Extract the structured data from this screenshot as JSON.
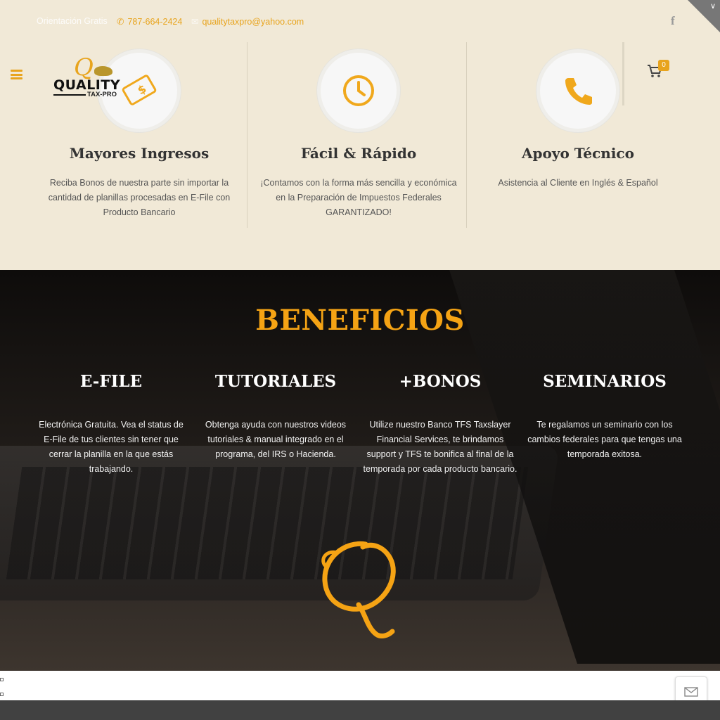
{
  "topbar": {
    "orientation": "Orientación Gratis",
    "phone": "787-664-2424",
    "email": "qualitytaxpro@yahoo.com",
    "phone_icon": "phone-icon",
    "email_icon": "mail-icon",
    "social_icon": "facebook-icon"
  },
  "header": {
    "logo_text": "QUALITY",
    "logo_subtext": "TAX-PRO",
    "cart_count": "0"
  },
  "features": [
    {
      "icon": "money-icon",
      "title": "Mayores Ingresos",
      "text": "Reciba Bonos de nuestra parte sin importar la cantidad de planillas procesadas en E-File con Producto Bancario"
    },
    {
      "icon": "clock-icon",
      "title": "Fácil & Rápido",
      "text": "¡Contamos con la forma más sencilla y económica en la Preparación de Impuestos Federales GARANTIZADO!"
    },
    {
      "icon": "phone-icon",
      "title": "Apoyo Técnico",
      "text": "Asistencia al Cliente en Inglés & Español"
    }
  ],
  "benefits": {
    "title": "BENEFICIOS",
    "items": [
      {
        "title": "E-FILE",
        "text": "Electrónica Gratuita. Vea el status de E-File de tus clientes sin tener que cerrar la planilla en la que estás trabajando."
      },
      {
        "title": "TUTORIALES",
        "text": "Obtenga ayuda con nuestros videos tutoriales & manual integrado en el programa, del IRS o Hacienda."
      },
      {
        "title": "+BONOS",
        "text": "Utilize nuestro Banco TFS Taxslayer Financial Services, te brindamos support y TFS te bonifica al final de la temporada por cada producto bancario."
      },
      {
        "title": "SEMINARIOS",
        "text": "Te regalamos un seminario con los cambios federales para que tengas una temporada exitosa."
      }
    ]
  },
  "colors": {
    "accent": "#e8a41d",
    "title": "#f5a314",
    "background": "#f1e9d7"
  }
}
